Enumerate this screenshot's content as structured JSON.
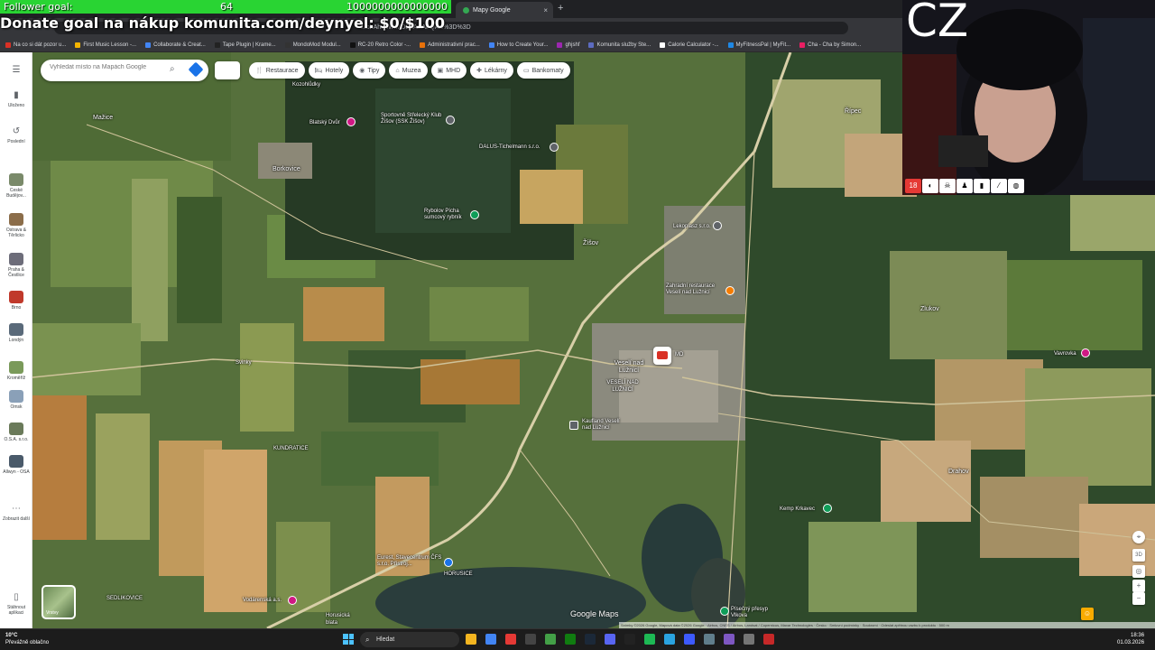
{
  "overlay": {
    "follower_goal_label": "Follower goal:",
    "follower_count": "64",
    "follower_target": "1000000000000000",
    "donate_text": "Donate goal na nákup komunita.com/deynyel: $0/$100",
    "cam_label": "CZ",
    "emote_18": "18"
  },
  "browser": {
    "tab_title": "Mapy Google",
    "tab_close": "×",
    "new_tab": "+",
    "url_fragment": "...bhAhwWXMDSoASAFQAw%3D%3D",
    "bookmarks": [
      {
        "label": "Na co si dát pozor u...",
        "color": "#d93025"
      },
      {
        "label": "First Music Lesson -...",
        "color": "#f4b400"
      },
      {
        "label": "Collaborate & Creat...",
        "color": "#4285f4"
      },
      {
        "label": "Tape Plugin | Krame...",
        "color": "#222222"
      },
      {
        "label": "MondoMod Modul...",
        "color": "#333333"
      },
      {
        "label": "RC-20 Retro Color -...",
        "color": "#111111"
      },
      {
        "label": "Administrativní prac...",
        "color": "#e8710a"
      },
      {
        "label": "How to Create Your...",
        "color": "#4285f4"
      },
      {
        "label": "ghjshf",
        "color": "#9c27b0"
      },
      {
        "label": "Komunita služby Ste...",
        "color": "#5c6bc0"
      },
      {
        "label": "Calorie Calculator -...",
        "color": "#ffffff"
      },
      {
        "label": "MyFitnessPal | MyFit...",
        "color": "#1e88e5"
      },
      {
        "label": "Cha - Cha by Simon...",
        "color": "#e91e63"
      }
    ]
  },
  "maps": {
    "search_placeholder": "Vyhledat místo na Mapách Google",
    "chips": [
      {
        "label": "Restaurace",
        "icon": "fork-knife-icon",
        "glyph": "🍴"
      },
      {
        "label": "Hotely",
        "icon": "bed-icon",
        "glyph": "🛏"
      },
      {
        "label": "Tipy",
        "icon": "camera-icon",
        "glyph": "◉"
      },
      {
        "label": "Muzea",
        "icon": "museum-icon",
        "glyph": "⌂"
      },
      {
        "label": "MHD",
        "icon": "bus-icon",
        "glyph": "▣"
      },
      {
        "label": "Lékárny",
        "icon": "pharmacy-icon",
        "glyph": "✚"
      },
      {
        "label": "Bankomaty",
        "icon": "atm-icon",
        "glyph": "▭"
      }
    ],
    "sidebar": {
      "saved": "Uloženo",
      "recent": "Poslední",
      "places": [
        {
          "label": "České Budějov...",
          "color": "#7a8a6a"
        },
        {
          "label": "Ostrava & Těrlicko",
          "color": "#8b6d4a"
        },
        {
          "label": "Praha & Čestlice",
          "color": "#6d6d7a"
        },
        {
          "label": "Brno",
          "color": "#c0392b"
        },
        {
          "label": "Londýn",
          "color": "#5a6a7a"
        },
        {
          "label": "Kroměříž",
          "color": "#7a9a5a"
        },
        {
          "label": "Omsk",
          "color": "#8aa0b8"
        },
        {
          "label": "O.S.A. s.r.o.",
          "color": "#6a7a5a"
        },
        {
          "label": "Allwyn - OSA",
          "color": "#4a5a6a"
        }
      ],
      "more": "Zobrazit další",
      "app": "Stáhnout aplikaci"
    },
    "labels": [
      {
        "text": "Mažice",
        "size": 7
      },
      {
        "text": "Borkovice",
        "size": 7
      },
      {
        "text": "Kozohlůdky",
        "size": 6
      },
      {
        "text": "Svinky",
        "size": 6
      },
      {
        "text": "KUNDRATICE",
        "size": 6
      },
      {
        "text": "SEDLIKOVICE",
        "size": 6
      },
      {
        "text": "Horusická blata",
        "size": 6
      },
      {
        "text": "HORUSICE",
        "size": 6
      },
      {
        "text": "Zlukov",
        "size": 7
      },
      {
        "text": "Vavrovka",
        "size": 6
      },
      {
        "text": "Řípec",
        "size": 7
      },
      {
        "text": "Drahov",
        "size": 7
      },
      {
        "text": "Žíšov",
        "size": 7
      },
      {
        "text": "Veselí nad Lužnicí",
        "size": 7
      },
      {
        "text": "VESELÍ NAD LUŽNICÍ",
        "size": 6
      }
    ],
    "pois": [
      {
        "text": "Blatský Dvůr",
        "color": "#d01884"
      },
      {
        "text": "Sportovně Střelecký Klub Žíšov (SSK Žíšov)",
        "color": "#5f6368"
      },
      {
        "text": "DALUS-Tichelmann s.r.o.",
        "color": "#5f6368"
      },
      {
        "text": "Rybolov Pícha sumcový rybník",
        "color": "#0f9d58"
      },
      {
        "text": "Lekoplasz s.r.o.",
        "color": "#5f6368"
      },
      {
        "text": "Zahradní restaurace Veselí nad Lužnicí",
        "color": "#f57c00"
      },
      {
        "text": "Kaufland Veselí nad Lužnicí",
        "color": "#5f6368"
      },
      {
        "text": "Kemp Krkavec",
        "color": "#0f9d58"
      },
      {
        "text": "Vodárenská a.s.",
        "color": "#d01884"
      },
      {
        "text": "Písečný přesyp Vlkova",
        "color": "#0f9d58"
      },
      {
        "text": "Eurest, Stavecentrum ČFS s.r.o. Přístroj...",
        "color": "#1a73e8"
      },
      {
        "text": "Vávrovka",
        "color": "#d01884"
      }
    ],
    "marker_label": "MD",
    "satellite_label": "Vrstvy",
    "brand": "Google Maps",
    "attribution": "Snímky ©2026 Google, Mapová data ©2026 Google · Airbus, CNES / Airbus, Landsat / Copernicus, Maxar Technologies · Česko · Smluvní podmínky · Soukromí · Odeslat zpětnou vazbu k produktu · 500 m",
    "controls": {
      "compass": "⌖",
      "zoom_in": "+",
      "zoom_out": "−",
      "threed": "3D",
      "pegman": "☺"
    }
  },
  "taskbar": {
    "temp": "10°C",
    "weather_desc": "Převážně oblačno",
    "search_label": "Hledat",
    "time": "18:36",
    "date": "01.03.2026",
    "apps": [
      {
        "name": "file-explorer-icon",
        "color": "#f3b520"
      },
      {
        "name": "chrome-icon",
        "color": "#4285f4"
      },
      {
        "name": "app-red-icon",
        "color": "#e53935"
      },
      {
        "name": "app-dark-icon",
        "color": "#444444"
      },
      {
        "name": "app-green-icon",
        "color": "#43a047"
      },
      {
        "name": "xbox-icon",
        "color": "#107c10"
      },
      {
        "name": "steam-icon",
        "color": "#1b2838"
      },
      {
        "name": "discord-icon",
        "color": "#5865f2"
      },
      {
        "name": "tiktok-icon",
        "color": "#222222"
      },
      {
        "name": "spotify-icon",
        "color": "#1db954"
      },
      {
        "name": "telegram-icon",
        "color": "#2aa3e0"
      },
      {
        "name": "app-blue-icon",
        "color": "#3d5afe"
      },
      {
        "name": "settings-icon",
        "color": "#607d8b"
      },
      {
        "name": "app-purple-icon",
        "color": "#7e57c2"
      },
      {
        "name": "app-grey-icon",
        "color": "#757575"
      },
      {
        "name": "obs-icon",
        "color": "#c62828"
      }
    ]
  }
}
